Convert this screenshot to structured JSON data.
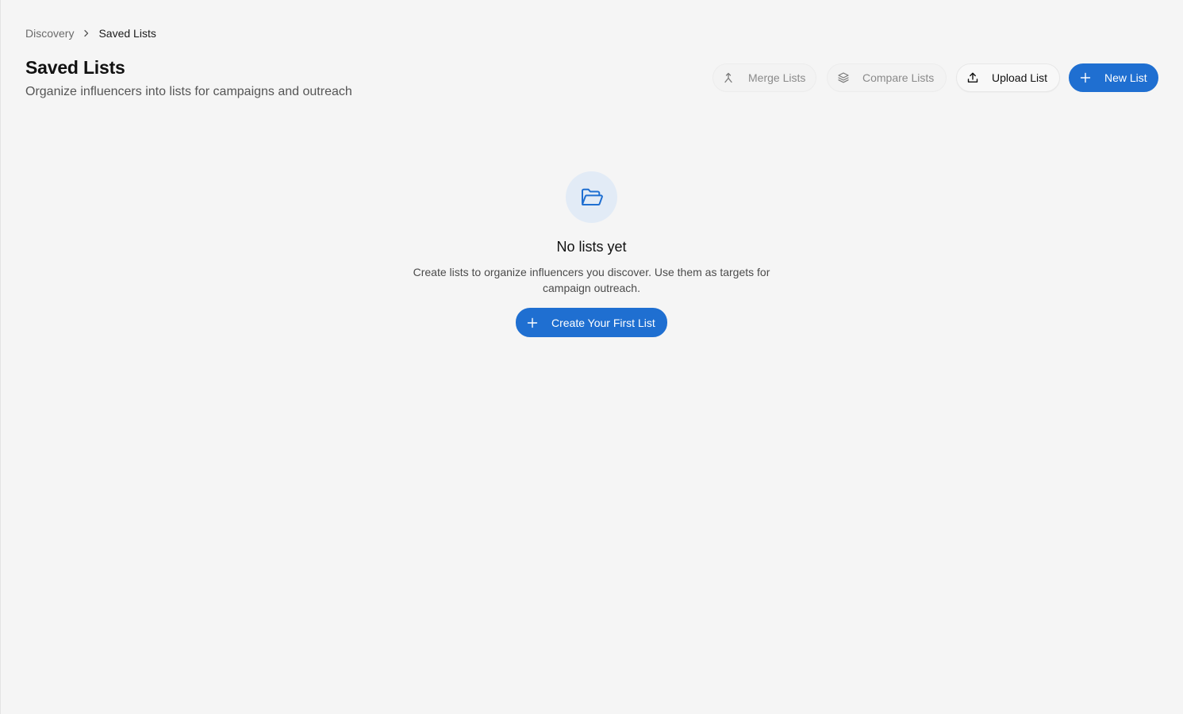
{
  "breadcrumb": {
    "parent": "Discovery",
    "current": "Saved Lists",
    "separator_icon": "chevron-right-icon"
  },
  "header": {
    "title": "Saved Lists",
    "subtitle": "Organize influencers into lists for campaigns and outreach"
  },
  "toolbar": {
    "merge": {
      "label": "Merge Lists",
      "icon": "merge-icon",
      "state": "disabled"
    },
    "compare": {
      "label": "Compare Lists",
      "icon": "layers-icon",
      "state": "disabled"
    },
    "upload": {
      "label": "Upload List",
      "icon": "upload-icon"
    },
    "new": {
      "label": "New List",
      "icon": "plus-icon"
    }
  },
  "empty_state": {
    "icon": "folder-open-icon",
    "title": "No lists yet",
    "description": "Create lists to organize influencers you discover. Use them as targets for campaign outreach.",
    "cta_label": "Create Your First List",
    "cta_icon": "plus-icon"
  },
  "colors": {
    "background": "#f5f5f5",
    "primary": "#1f6fd1",
    "icon_circle": "#e2ebf6",
    "muted_text": "#8a8a8a"
  }
}
